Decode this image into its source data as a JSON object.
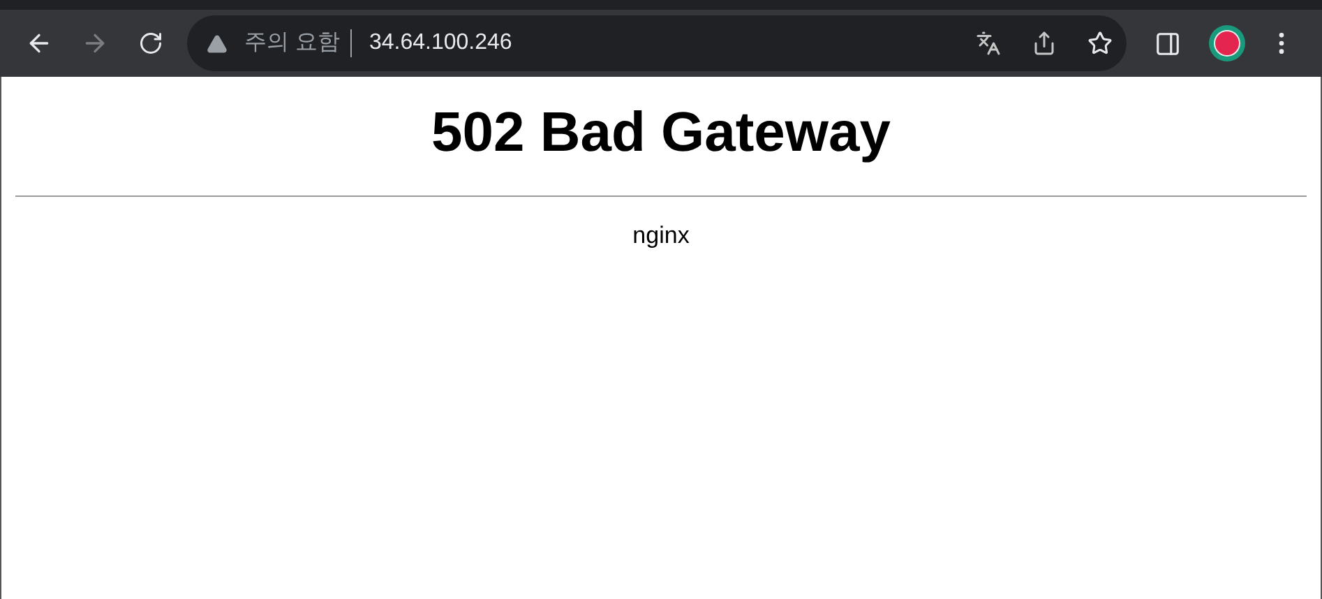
{
  "browser": {
    "forward_disabled": true,
    "security_label": "주의 요함",
    "url": "34.64.100.246"
  },
  "page": {
    "heading": "502 Bad Gateway",
    "server": "nginx"
  }
}
